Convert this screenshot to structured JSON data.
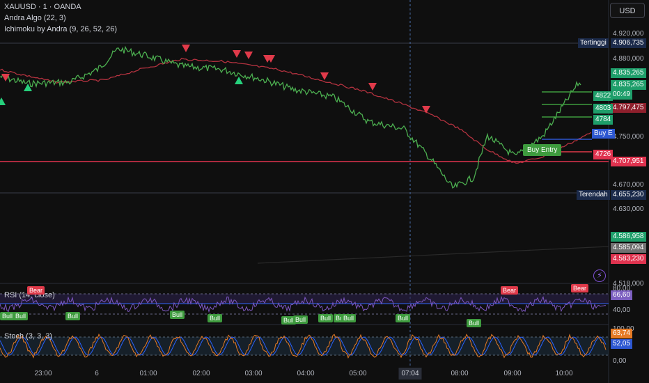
{
  "header": {
    "symbol": "XAUUSD · 1 · OANDA",
    "indicator1": "Andra Algo (22, 3)",
    "indicator2": "Ichimoku by Andra (9, 26, 52, 26)",
    "currency": "USD"
  },
  "price_axis": {
    "ticks": [
      "4.920,000",
      "4.880,000",
      "4.750,000",
      "4.670,000",
      "4.630,000",
      "4.518,000"
    ],
    "rsi_ticks": [
      "80,00",
      "40,00"
    ],
    "stoch_ticks": [
      "100,00",
      "0,00"
    ]
  },
  "price_tags": {
    "high_label": "Tertinggi",
    "high_value": "4.906,735",
    "low_label": "Terendah",
    "low_value": "4.655,230",
    "t1": "4.835,265",
    "t2": "4.835,265",
    "t2_timer": "00:49",
    "t3": "4.797,475",
    "t4": "4.707,951",
    "t5": "4.586,958",
    "t6": "4.585,094",
    "t7": "4.583,230",
    "rsi_value": "66,60",
    "stoch_k": "63,74",
    "stoch_d": "52,05"
  },
  "levels": {
    "l1": "4822",
    "l2": "4803",
    "l3": "4784",
    "l4": "4726",
    "buy_flag": "Buy E"
  },
  "signals": {
    "buy_entry": "Buy Entry"
  },
  "panes": {
    "rsi": "RSI (14, close)",
    "stoch": "Stoch (3, 3, 3)"
  },
  "rsi_markers": {
    "bear": "Bear",
    "bull": "Bull"
  },
  "time_axis": {
    "labels": [
      "23:00",
      "6",
      "01:00",
      "02:00",
      "03:00",
      "04:00",
      "05:00",
      "08:00",
      "09:00",
      "10:00"
    ],
    "cursor": "07:04"
  },
  "colors": {
    "bull": "#3e9b3e",
    "bear": "#e03a4a",
    "price_line": "#4caf50",
    "cloud_line": "#b2323f"
  }
}
